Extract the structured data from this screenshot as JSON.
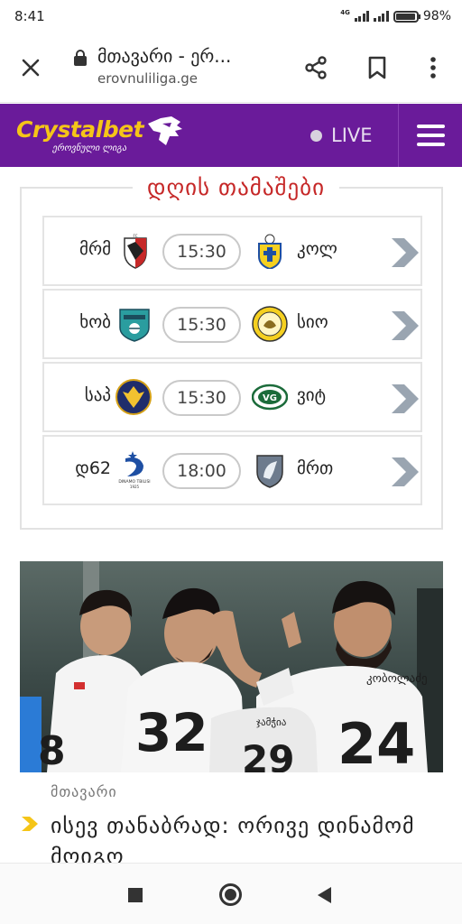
{
  "status_bar": {
    "time": "8:41",
    "network": "4G",
    "battery": "98%",
    "battery_level": 0.98
  },
  "browser": {
    "page_title": "მთავარი - ერ...",
    "domain": "erovnuliliga.ge"
  },
  "site_header": {
    "logo_main": "Crystalbet",
    "logo_sub": "ეროვნული ლიგა",
    "live_label": "LIVE",
    "colors": {
      "header_bg": "#6a1b9a",
      "logo": "#f5c518"
    }
  },
  "games": {
    "title": "დღის თამაშები",
    "matches": [
      {
        "home": "მრმ",
        "time": "15:30",
        "away": "კოლ",
        "home_logo": "shield-red-black-logo",
        "away_logo": "shield-yellow-blue-logo"
      },
      {
        "home": "ხობ",
        "time": "15:30",
        "away": "სიო",
        "home_logo": "shield-teal-logo",
        "away_logo": "round-yellow-logo"
      },
      {
        "home": "საპ",
        "time": "15:30",
        "away": "ვიტ",
        "home_logo": "round-blue-eagle-logo",
        "away_logo": "oval-green-logo"
      },
      {
        "home": "დ62",
        "time": "18:00",
        "away": "მრთ",
        "home_logo": "dinamo-tbilisi-logo",
        "away_logo": "shield-grey-horse-logo"
      }
    ],
    "dinamo_text": "DINAMO TBILISI",
    "dinamo_year": "1925"
  },
  "article": {
    "category": "მთავარი",
    "headline": "ისევ თანაბრად: ორივე დინამომ მოიგო",
    "jersey_numbers": [
      "32",
      "24",
      "8",
      "29"
    ],
    "jersey_name": "კობოლაძე",
    "jersey_name_2": "ჯამჭია"
  }
}
